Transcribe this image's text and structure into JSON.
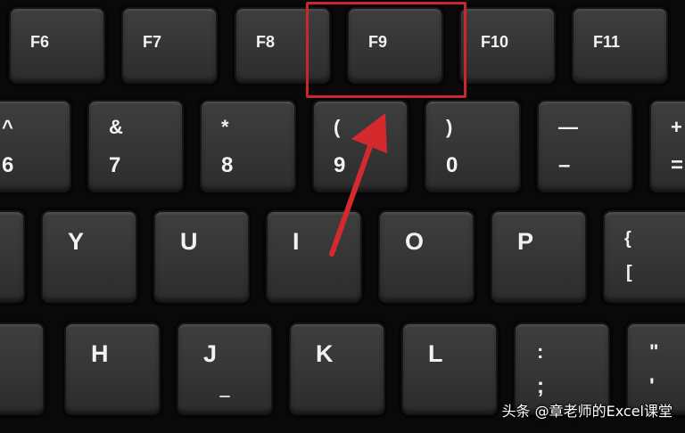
{
  "function_keys": [
    "F6",
    "F7",
    "F8",
    "F9",
    "F10",
    "F11"
  ],
  "number_keys": [
    {
      "shift": "^",
      "base": "6"
    },
    {
      "shift": "&",
      "base": "7"
    },
    {
      "shift": "*",
      "base": "8"
    },
    {
      "shift": "(",
      "base": "9"
    },
    {
      "shift": ")",
      "base": "0"
    },
    {
      "shift": "—",
      "base": "–"
    },
    {
      "shift": "+",
      "base": "="
    }
  ],
  "top_letter_keys": [
    "Y",
    "U",
    "I",
    "O",
    "P"
  ],
  "bracket_key": {
    "shift": "{",
    "base": "["
  },
  "home_letter_keys": [
    "H",
    "J",
    "K",
    "L"
  ],
  "semicolon_key": {
    "shift": ":",
    "base": ";"
  },
  "quote_key": {
    "shift": "\"",
    "base": "'"
  },
  "highlighted_key": "F9",
  "annotation": {
    "box_color": "#c8282c",
    "arrow_color": "#d42a2e"
  },
  "watermark": "头条 @章老师的Excel课堂"
}
